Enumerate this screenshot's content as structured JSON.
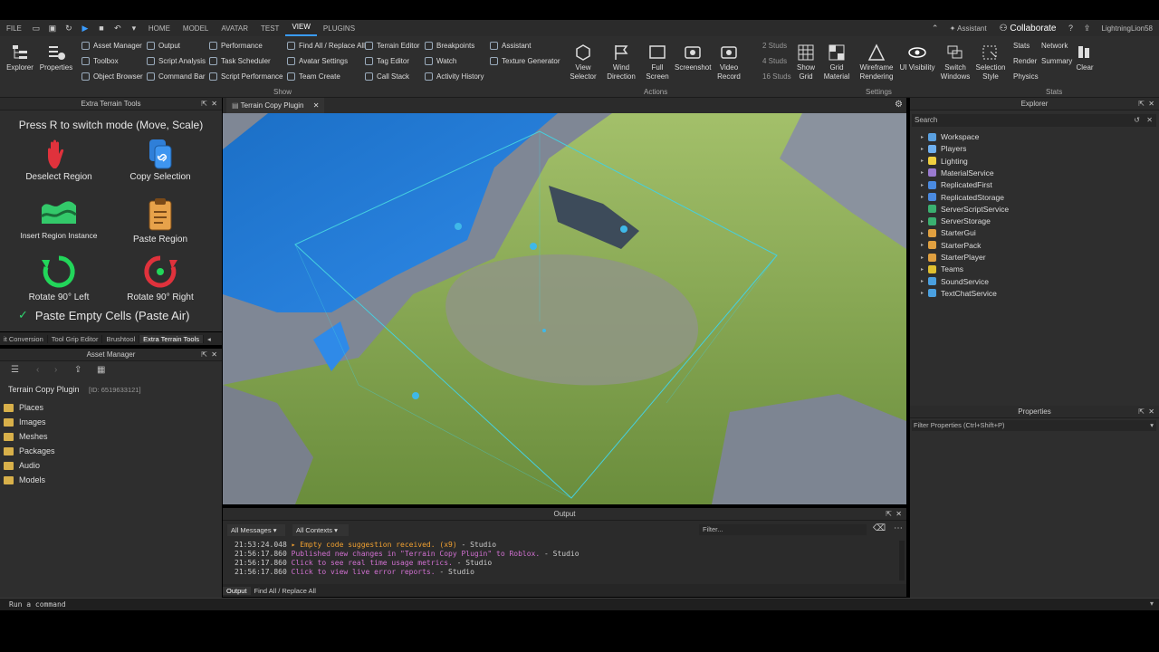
{
  "menubar": {
    "file": "FILE",
    "tabs": [
      "HOME",
      "MODEL",
      "AVATAR",
      "TEST",
      "VIEW",
      "PLUGINS"
    ],
    "active_tab": "VIEW",
    "assistant": "Assistant",
    "collaborate": "Collaborate",
    "username": "LightningLion58"
  },
  "ribbon": {
    "explorer": "Explorer",
    "properties": "Properties",
    "show_col1": [
      "Asset Manager",
      "Toolbox",
      "Object Browser"
    ],
    "show_col2": [
      "Output",
      "Script Analysis",
      "Command Bar"
    ],
    "show_col3": [
      "Performance",
      "Task Scheduler",
      "Script Performance"
    ],
    "show_col4": [
      "Find All / Replace All",
      "Avatar Settings",
      "Team Create"
    ],
    "show_col5": [
      "Terrain Editor",
      "Tag Editor",
      "Call Stack"
    ],
    "show_col6": [
      "Breakpoints",
      "Watch",
      "Activity History"
    ],
    "show_col7": [
      "Assistant",
      "Texture Generator"
    ],
    "show_label": "Show",
    "actions": [
      "View Selector",
      "Wind Direction",
      "Full Screen",
      "Screenshot",
      "Video Record"
    ],
    "actions_label": "Actions",
    "studs": [
      "2 Studs",
      "4 Studs",
      "16 Studs"
    ],
    "settings": [
      "Show Grid",
      "Grid Material",
      "Wireframe Rendering",
      "UI Visibility",
      "Switch Windows",
      "Selection Style"
    ],
    "settings_label": "Settings",
    "stats": [
      "Stats",
      "Network",
      "Render",
      "Summary",
      "Physics"
    ],
    "clear": "Clear",
    "stats_label": "Stats"
  },
  "terrain_tools": {
    "title": "Extra Terrain Tools",
    "hint": "Press R to switch mode (Move, Scale)",
    "tools": [
      "Deselect Region",
      "Copy Selection",
      "Insert Region Instance",
      "Paste Region",
      "Rotate 90° Left",
      "Rotate 90° Right"
    ],
    "checkbox_label": "Paste Empty Cells (Paste Air)",
    "checkbox_mark": "✓"
  },
  "plugin_tabs": [
    "it Conversion",
    "Tool Grip Editor",
    "Brushtool",
    "Extra Terrain Tools"
  ],
  "asset_manager": {
    "title": "Asset Manager",
    "project": "Terrain Copy Plugin",
    "project_id": "[ID: 6519633121]",
    "folders": [
      "Places",
      "Images",
      "Meshes",
      "Packages",
      "Audio",
      "Models"
    ]
  },
  "viewport": {
    "tab_label": "Terrain Copy Plugin"
  },
  "explorer": {
    "title": "Explorer",
    "search_placeholder": "Search",
    "items": [
      "Workspace",
      "Players",
      "Lighting",
      "MaterialService",
      "ReplicatedFirst",
      "ReplicatedStorage",
      "ServerScriptService",
      "ServerStorage",
      "StarterGui",
      "StarterPack",
      "StarterPlayer",
      "Teams",
      "SoundService",
      "TextChatService"
    ],
    "icon_colors": [
      "#5aa0e0",
      "#6fb0f0",
      "#f0d040",
      "#9a7ad0",
      "#4a8ae0",
      "#4a8ae0",
      "#3ab070",
      "#3ab070",
      "#e0a040",
      "#e0a040",
      "#e0a040",
      "#e0c030",
      "#4aa0e0",
      "#4aa0e0"
    ]
  },
  "properties": {
    "title": "Properties",
    "filter_placeholder": "Filter Properties (Ctrl+Shift+P)"
  },
  "output": {
    "title": "Output",
    "filter_messages": "All Messages",
    "filter_contexts": "All Contexts",
    "filter_placeholder": "Filter...",
    "lines": [
      {
        "time": "21:53:24.048",
        "msg": "▸ Empty code suggestion received. (x9)",
        "src": "Studio",
        "color": "#f0a030"
      },
      {
        "time": "21:56:17.860",
        "msg": "Published new changes in \"Terrain Copy Plugin\" to Roblox.",
        "src": "Studio",
        "color": "#d070d0"
      },
      {
        "time": "21:56:17.860",
        "msg": "Click to see real time usage metrics.",
        "src": "Studio",
        "color": "#d070d0"
      },
      {
        "time": "21:56:17.860",
        "msg": "Click to view live error reports.",
        "src": "Studio",
        "color": "#d070d0"
      }
    ],
    "bottom_tabs": [
      "Output",
      "Find All / Replace All"
    ]
  },
  "command_bar": {
    "placeholder": "Run a command"
  }
}
